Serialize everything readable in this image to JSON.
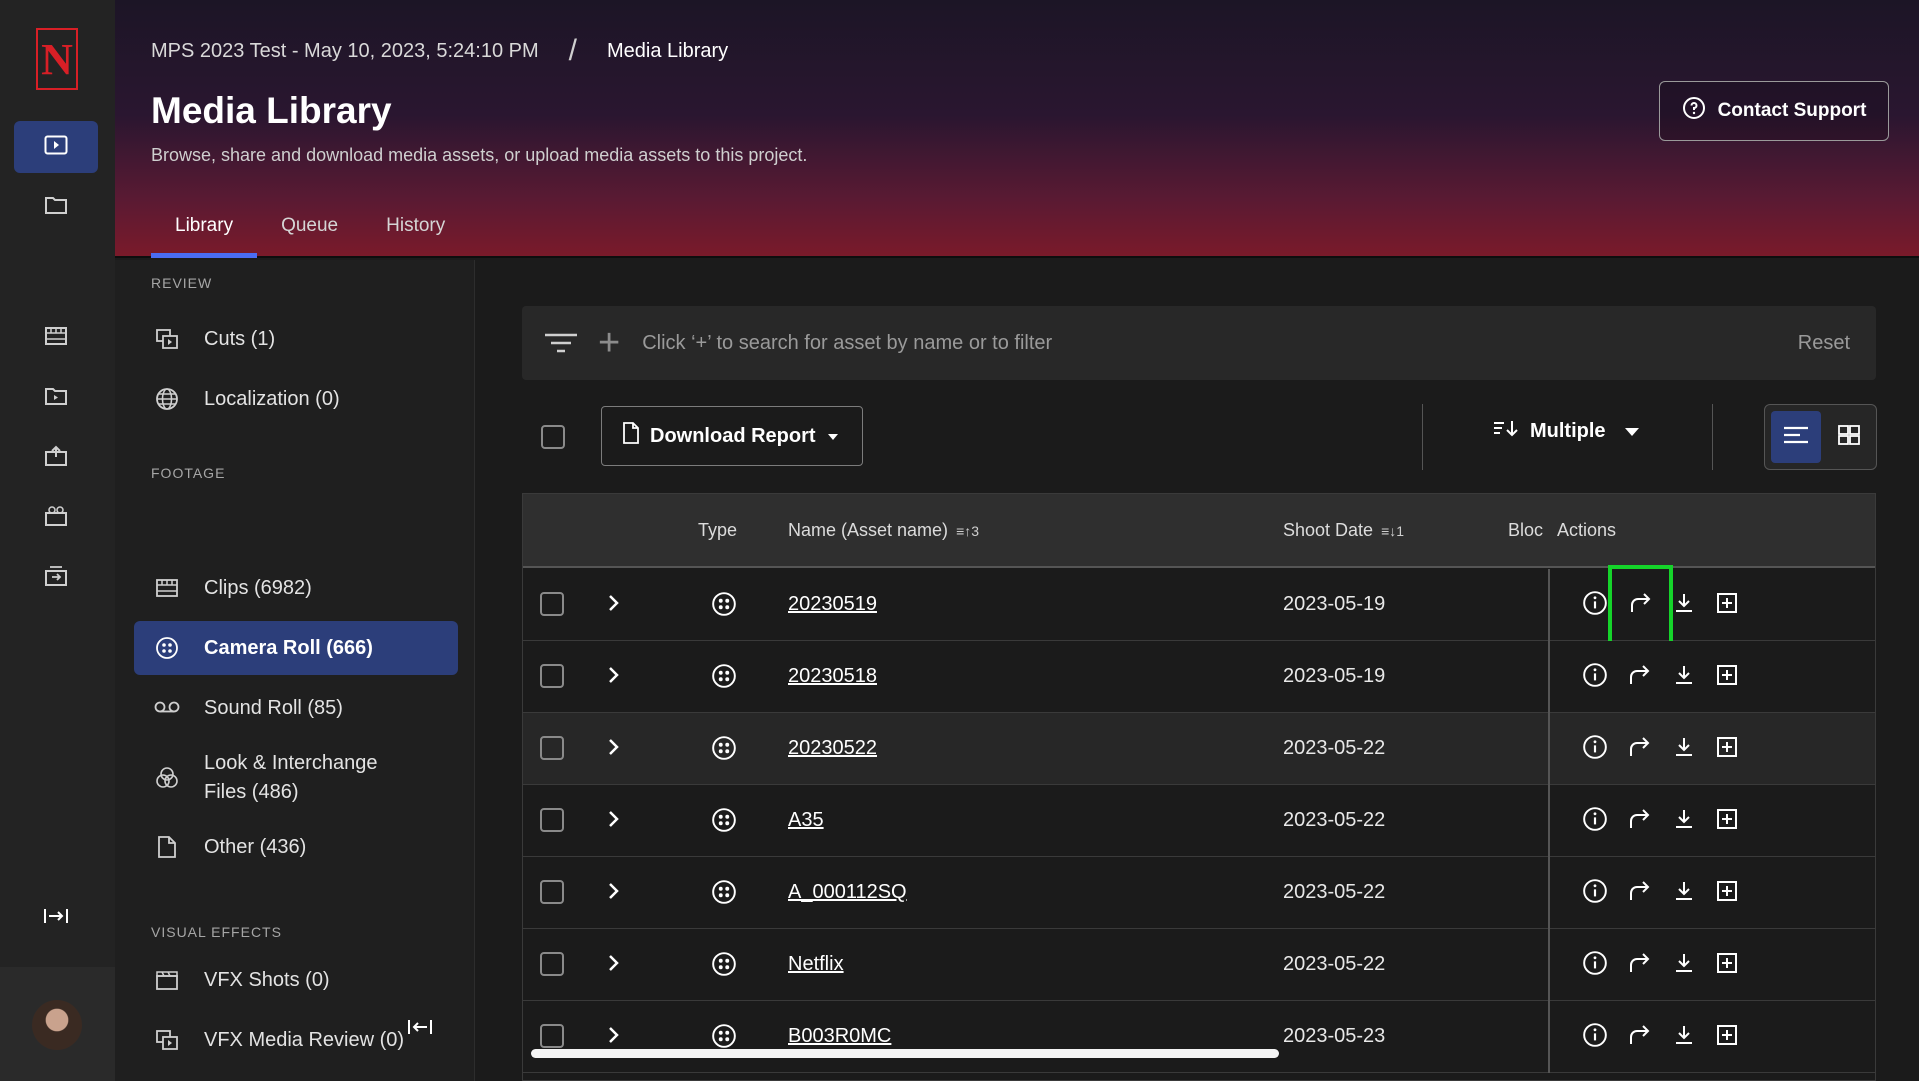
{
  "header": {
    "project": "MPS 2023 Test - May 10, 2023, 5:24:10 PM",
    "separator": "/",
    "current": "Media Library",
    "title": "Media Library",
    "subtitle": "Browse, share and download media assets, or upload media assets to this project.",
    "contact_label": "Contact Support",
    "tabs": [
      {
        "label": "Library",
        "active": true
      },
      {
        "label": "Queue",
        "active": false
      },
      {
        "label": "History",
        "active": false
      }
    ]
  },
  "rail": {
    "logo": "N",
    "icons": [
      "play-square-icon",
      "folder-icon",
      "clips-icon",
      "review-folder-icon",
      "upload-icon",
      "camera-icon",
      "export-icon",
      "expand-icon"
    ]
  },
  "sidebar": {
    "sections": {
      "review": "REVIEW",
      "footage": "FOOTAGE",
      "visual_effects": "VISUAL EFFECTS"
    },
    "items": {
      "cuts": "Cuts (1)",
      "localization": "Localization (0)",
      "clips": "Clips (6982)",
      "camera_roll": "Camera Roll (666)",
      "sound_roll": "Sound Roll (85)",
      "look_line1": "Look & Interchange",
      "look_line2": "Files (486)",
      "other": "Other (436)",
      "vfx_shots": "VFX Shots (0)",
      "vfx_media_review": "VFX Media Review (0)"
    }
  },
  "search": {
    "placeholder": "Click ‘+’ to search for asset by name or to filter",
    "reset": "Reset"
  },
  "toolbar": {
    "download_report": "Download Report",
    "sort_label": "Multiple"
  },
  "table": {
    "headers": {
      "type": "Type",
      "name": "Name (Asset name)",
      "name_sort": "3",
      "shoot_date": "Shoot Date",
      "shoot_date_sort": "1",
      "bloc": "Bloc",
      "actions": "Actions"
    },
    "rows": [
      {
        "name": "20230519",
        "date": "2023-05-19"
      },
      {
        "name": "20230518",
        "date": "2023-05-19"
      },
      {
        "name": "20230522",
        "date": "2023-05-22"
      },
      {
        "name": "A35",
        "date": "2023-05-22"
      },
      {
        "name": "A_000112SQ",
        "date": "2023-05-22"
      },
      {
        "name": "Netflix",
        "date": "2023-05-22"
      },
      {
        "name": "B003R0MC",
        "date": "2023-05-23"
      }
    ]
  },
  "colors": {
    "accent": "#2c3e7a",
    "tab_indicator": "#4a6cf2",
    "brand_red": "#d81f26",
    "focus": "#15d42a"
  }
}
